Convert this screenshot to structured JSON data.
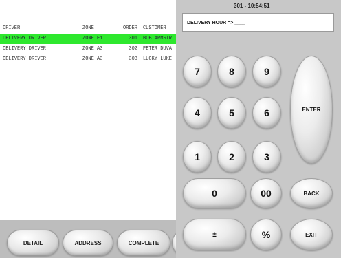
{
  "table": {
    "columns": [
      "DRIVER",
      "ZONE",
      "ORDER",
      "CUSTOMER"
    ],
    "rows": [
      {
        "driver": "DELIVERY DRIVER",
        "zone": "ZONE E1",
        "order": "301",
        "customer": "BOB ARMSTR",
        "selected": true
      },
      {
        "driver": "DELIVERY DRIVER",
        "zone": "ZONE A3",
        "order": "302",
        "customer": "PETER DUVA",
        "selected": false
      },
      {
        "driver": "DELIVERY DRIVER",
        "zone": "ZONE A3",
        "order": "303",
        "customer": "LUCKY LUKE",
        "selected": false
      }
    ]
  },
  "tabs": {
    "detail": "DETAIL",
    "address": "ADDRESS",
    "complete": "COMPLETE"
  },
  "status": {
    "text": "301 - 10:54:51"
  },
  "prompt": {
    "text": "DELIVERY HOUR  =>  ____"
  },
  "keypad": {
    "k7": "7",
    "k8": "8",
    "k9": "9",
    "k4": "4",
    "k5": "5",
    "k6": "6",
    "k1": "1",
    "k2": "2",
    "k3": "3",
    "k0": "0",
    "k00": "00",
    "plusminus": "±",
    "percent": "%",
    "enter": "ENTER",
    "back": "BACK",
    "exit": "EXIT"
  },
  "colors": {
    "selected_row": "#2ee82e",
    "panel_bg": "#c8c8c8",
    "tabbar_bg": "#bdbdbd"
  }
}
